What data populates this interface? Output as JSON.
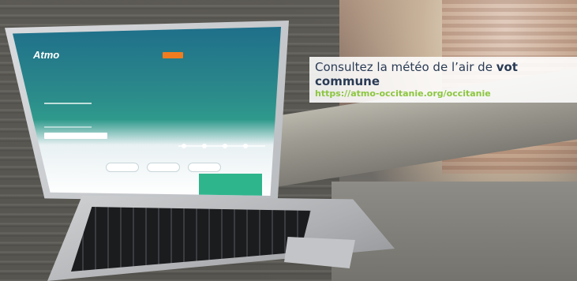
{
  "screen": {
    "logo": "Atmo"
  },
  "caption": {
    "text_prefix": "Consultez la météo de l’air de ",
    "text_bold_1": "vot",
    "text_bold_2": "commune",
    "url": "https://atmo-occitanie.org/occitanie"
  },
  "colors": {
    "link": "#8cc63f",
    "heading": "#2a3b55",
    "accent_orange": "#f07c1f",
    "accent_green": "#2fb58c"
  }
}
